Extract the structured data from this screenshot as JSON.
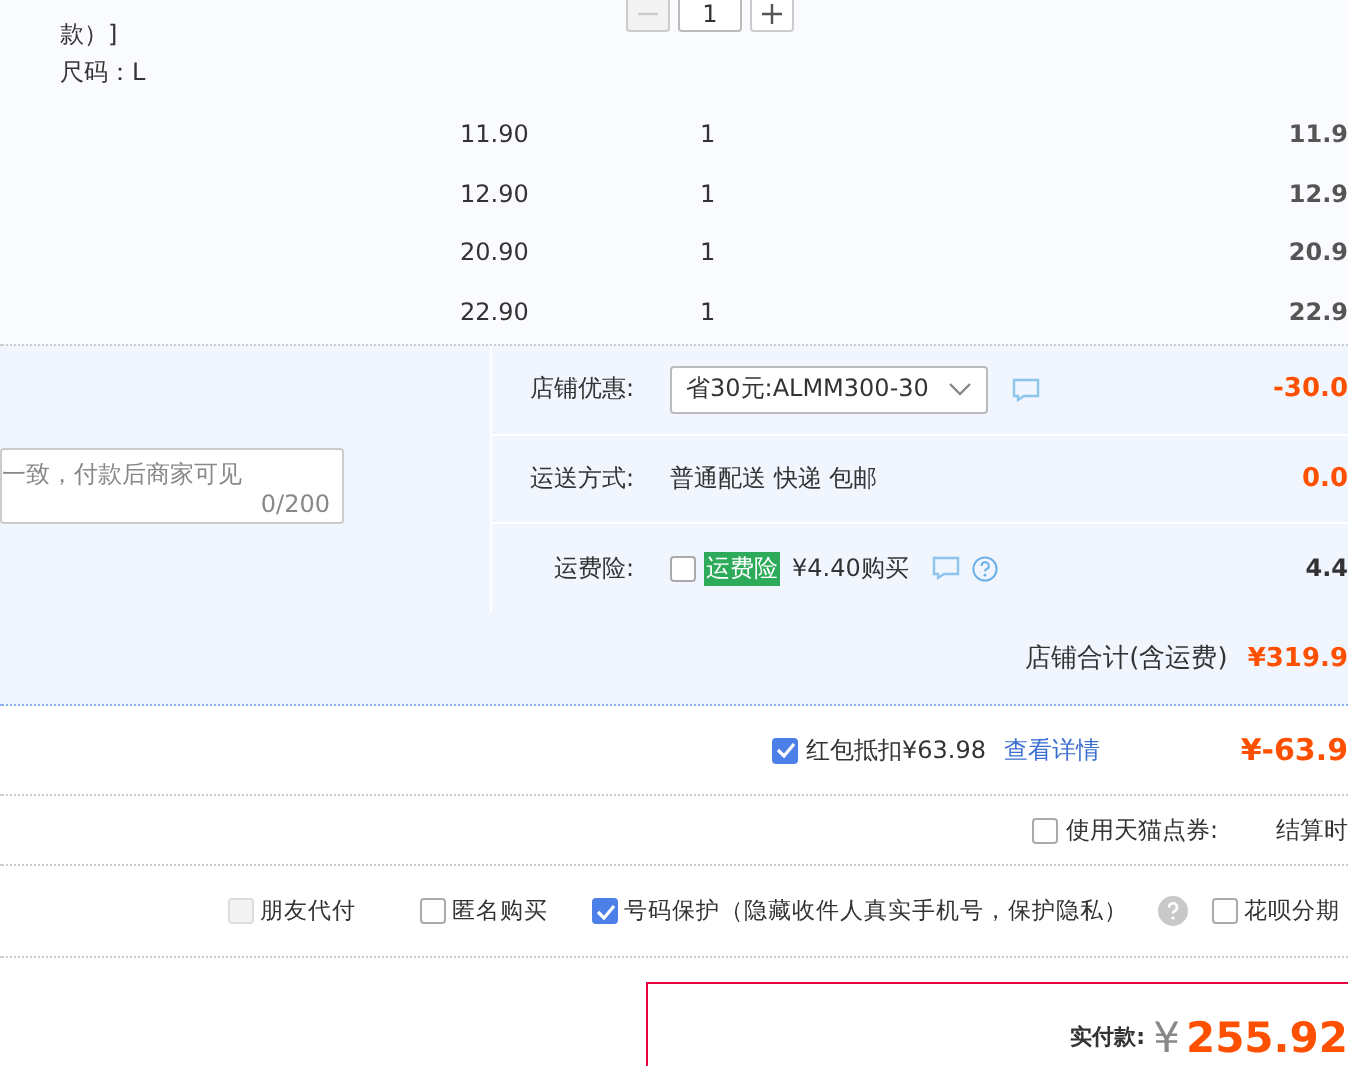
{
  "product": {
    "spec_lines": [
      "款）]",
      "尺码：L"
    ],
    "quantity": "1",
    "minus_disabled": true
  },
  "items": [
    {
      "price": "11.90",
      "quantity": "1",
      "subtotal": "11.9"
    },
    {
      "price": "12.90",
      "quantity": "1",
      "subtotal": "12.9"
    },
    {
      "price": "20.90",
      "quantity": "1",
      "subtotal": "20.9"
    },
    {
      "price": "22.90",
      "quantity": "1",
      "subtotal": "22.9"
    }
  ],
  "message": {
    "placeholder": "一致，付款后商家可见",
    "counter": "0/200"
  },
  "options": [
    {
      "kind": "select",
      "label": "店铺优惠:",
      "value": "省30元:ALMM300-30",
      "amount": "-30.0",
      "highlight": true
    },
    {
      "kind": "text",
      "label": "运送方式:",
      "value": "普通配送 快递 包邮",
      "amount": "0.0",
      "highlight": true
    },
    {
      "kind": "insurance",
      "label": "运费险:",
      "checked": false,
      "badge": "运费险",
      "value": "¥4.40购买",
      "amount": "4.4",
      "highlight": false
    }
  ],
  "store_total": {
    "label": "店铺合计(含运费)",
    "amount": "¥319.9"
  },
  "red_packet": {
    "checked": true,
    "label": "红包抵扣¥63.98",
    "link": "查看详情",
    "amount": "¥-63.9"
  },
  "coupon": {
    "checked": false,
    "label": "使用天猫点券:",
    "note": "结算时"
  },
  "extras": [
    {
      "label": "朋友代付",
      "checked": false,
      "disabled": true,
      "help": false
    },
    {
      "label": "匿名购买",
      "checked": false,
      "disabled": false,
      "help": false
    },
    {
      "label": "号码保护（隐藏收件人真实手机号，保护隐私）",
      "checked": true,
      "disabled": false,
      "help": true
    },
    {
      "label": "花呗分期",
      "checked": false,
      "disabled": false,
      "help": false
    }
  ],
  "payment": {
    "label": "实付款:",
    "currency": "¥",
    "amount": "255.92"
  }
}
